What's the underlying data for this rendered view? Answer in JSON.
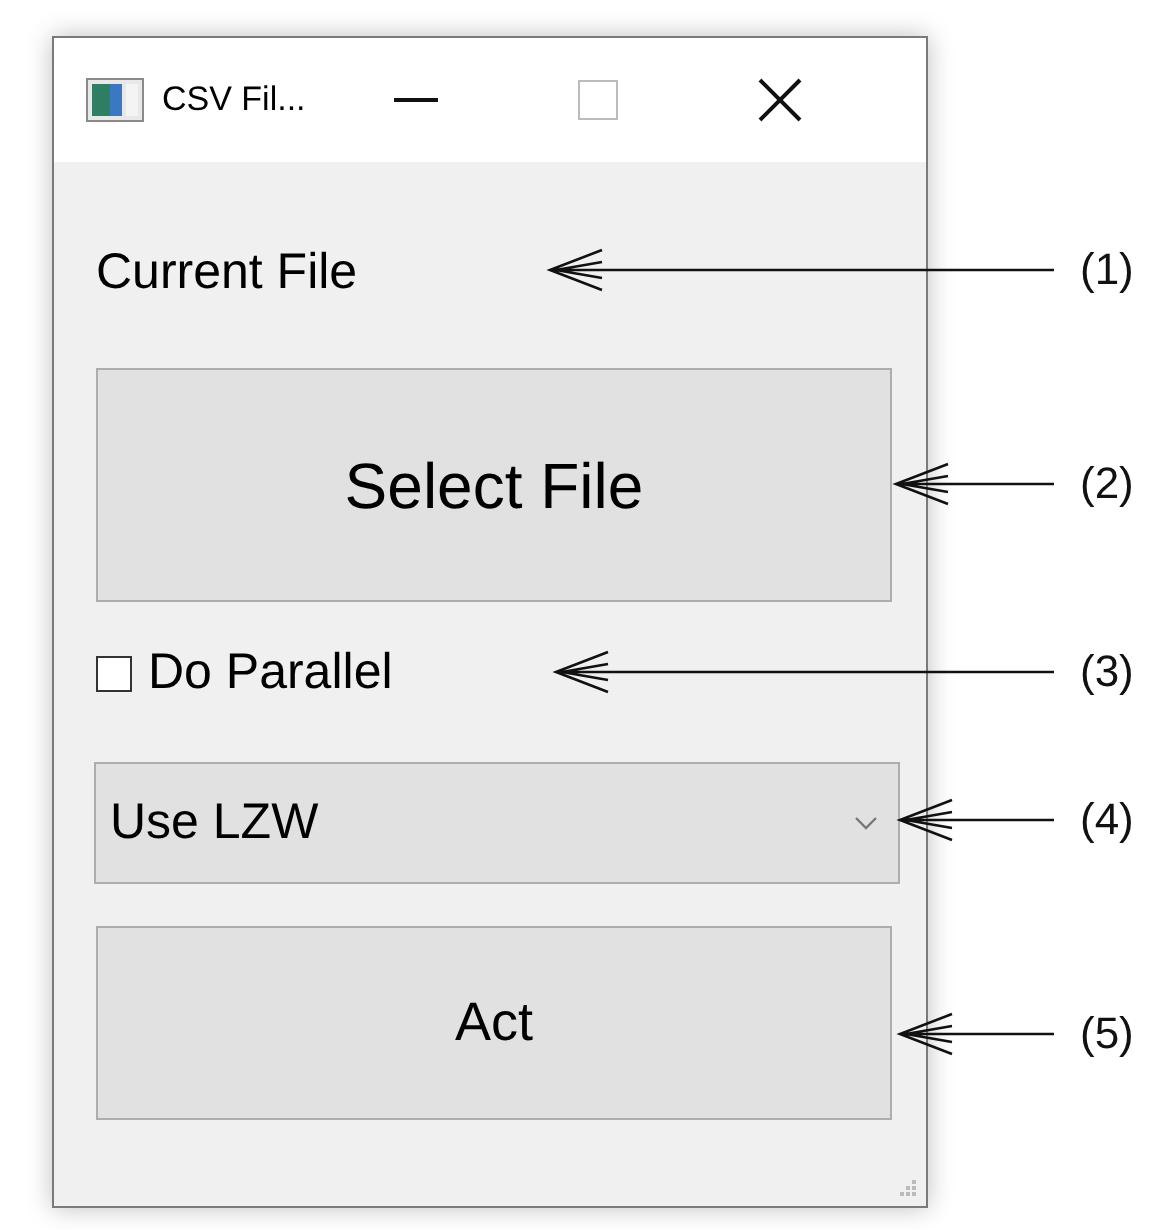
{
  "window": {
    "title": "CSV Fil..."
  },
  "current_file_label": "Current File",
  "select_button": {
    "label": "Select File"
  },
  "checkbox": {
    "label": "Do Parallel",
    "checked": false
  },
  "dropdown": {
    "value": "Use LZW"
  },
  "act_button": {
    "label": "Act"
  },
  "annotations": [
    {
      "label": "(1)"
    },
    {
      "label": "(2)"
    },
    {
      "label": "(3)"
    },
    {
      "label": "(4)"
    },
    {
      "label": "(5)"
    }
  ]
}
